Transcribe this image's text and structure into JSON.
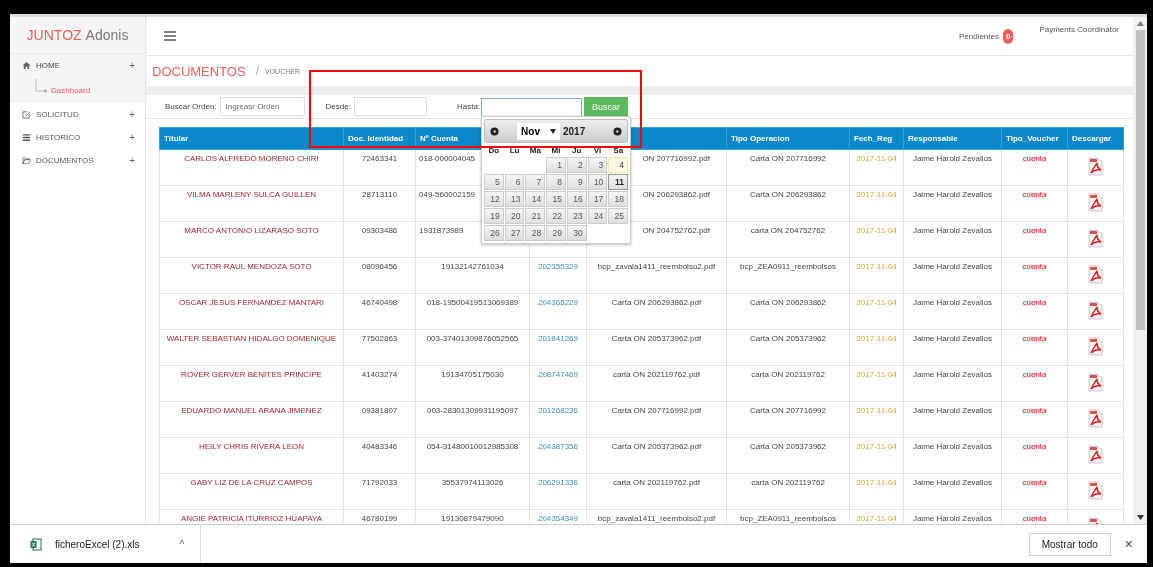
{
  "brand": {
    "accent": "JUNTOZ",
    "rest": "Adonis"
  },
  "sidebar": {
    "items": [
      {
        "label": "HOME",
        "expand": "+",
        "expanded": true,
        "children": [
          {
            "label": "Dashboard",
            "selected": true
          }
        ]
      },
      {
        "label": "SOLICITUD",
        "expand": "+",
        "expanded": false
      },
      {
        "label": "HISTORICO",
        "expand": "+",
        "expanded": false
      },
      {
        "label": "DOCUMENTOS",
        "expand": "+",
        "expanded": false
      }
    ]
  },
  "topbar": {
    "pending_label": "Pendientes",
    "pending_count": "0",
    "user": "Payments Coordinator"
  },
  "page": {
    "title": "DOCUMENTOS",
    "separator": "/",
    "breadcrumb": "VOUCHER"
  },
  "filters": {
    "order_label": "Buscar Orden:",
    "order_placeholder": "Ingreasr Orden",
    "from_label": "Desde:",
    "to_label": "Hasta:",
    "button": "Buscar"
  },
  "calendar": {
    "month": "Nov",
    "year": "2017",
    "weekdays": [
      "Do",
      "Lu",
      "Ma",
      "Mi",
      "Ju",
      "Vi",
      "Sa"
    ],
    "weeks": [
      {
        "right_aligned": true,
        "days": [
          {
            "d": "1",
            "today": false,
            "selected": false
          },
          {
            "d": "2",
            "today": false,
            "selected": false
          },
          {
            "d": "3",
            "today": false,
            "selected": false
          },
          {
            "d": "4",
            "today": true,
            "selected": false
          }
        ]
      },
      {
        "days": [
          {
            "d": "5",
            "today": false,
            "selected": false
          },
          {
            "d": "6",
            "today": false,
            "selected": false
          },
          {
            "d": "7",
            "today": false,
            "selected": false
          },
          {
            "d": "8",
            "today": false,
            "selected": false
          },
          {
            "d": "9",
            "today": false,
            "selected": false
          },
          {
            "d": "10",
            "today": false,
            "selected": false
          },
          {
            "d": "11",
            "today": false,
            "selected": true
          }
        ]
      },
      {
        "days": [
          {
            "d": "12",
            "today": false,
            "selected": false
          },
          {
            "d": "13",
            "today": false,
            "selected": false
          },
          {
            "d": "14",
            "today": false,
            "selected": false
          },
          {
            "d": "15",
            "today": false,
            "selected": false
          },
          {
            "d": "16",
            "today": false,
            "selected": false
          },
          {
            "d": "17",
            "today": false,
            "selected": false
          },
          {
            "d": "18",
            "today": false,
            "selected": false
          }
        ]
      },
      {
        "days": [
          {
            "d": "19",
            "today": false,
            "selected": false
          },
          {
            "d": "20",
            "today": false,
            "selected": false
          },
          {
            "d": "21",
            "today": false,
            "selected": false
          },
          {
            "d": "22",
            "today": false,
            "selected": false
          },
          {
            "d": "23",
            "today": false,
            "selected": false
          },
          {
            "d": "24",
            "today": false,
            "selected": false
          },
          {
            "d": "25",
            "today": false,
            "selected": false
          }
        ]
      },
      {
        "days": [
          {
            "d": "26",
            "today": false,
            "selected": false
          },
          {
            "d": "27",
            "today": false,
            "selected": false
          },
          {
            "d": "28",
            "today": false,
            "selected": false
          },
          {
            "d": "29",
            "today": false,
            "selected": false
          },
          {
            "d": "30",
            "today": false,
            "selected": false
          }
        ]
      }
    ]
  },
  "table": {
    "columns": [
      "Titular",
      "Doc. Identidad",
      "Nº Cuenta",
      null,
      null,
      "Tipo Operacion",
      "Fech_Reg",
      "Responsable",
      "Tipo_Voucher",
      "Descargar"
    ],
    "rows": [
      {
        "cells": [
          "CARLOS ALFREDO MORENO CHIRI",
          "72463341",
          {
            "text": "018-000004045",
            "align_left": true
          },
          null,
          {
            "text": "ON 207716992.pdf",
            "align_right": true
          },
          "Carta ON 207716992",
          "2017-11-04",
          "Jaime Harold Zevallos",
          "cuenta"
        ]
      },
      {
        "cells": [
          "VILMA MARLENY SULCA GUILLEN",
          "28713110",
          {
            "text": "049-560002159",
            "align_left": true
          },
          null,
          {
            "text": "ON 206293862.pdf",
            "align_right": true
          },
          "Carta ON 206293862",
          "2017-11-04",
          "Jaime Harold Zevallos",
          "cuenta"
        ]
      },
      {
        "cells": [
          "MARCO ANTONIO LIZARASO SOTO",
          "09303486",
          {
            "text": "1931873989",
            "align_left": true
          },
          null,
          {
            "text": "ON 204752762.pdf",
            "align_right": true
          },
          "carta ON 204752762",
          "2017-11-04",
          "Jaime Harold Zevallos",
          "cuenta"
        ]
      },
      {
        "cells": [
          "VICTOR RAUL MENDOZA SOTO",
          "08096456",
          "19132142761034",
          "202355329",
          "bcp_zavala1411_reembolso2.pdf",
          "bcp_ZEA0911_reembolsos",
          "2017-11-04",
          "Jaime Harold Zevallos",
          "cuenta"
        ]
      },
      {
        "cells": [
          "OSCAR JESUS FERNANDEZ MANTARI",
          "46740498",
          "018-19500419513069389",
          "204365229",
          "Carta ON 206293862.pdf",
          "Carta ON 206293862",
          "2017-11-04",
          "Jaime Harold Zevallos",
          "cuenta"
        ]
      },
      {
        "cells": [
          "WALTER SEBASTIAN HIDALGO DOMENIQUE",
          "77502863",
          "003-37401309876052565",
          "201841269",
          "Carta ON 205373962.pdf",
          "Carta ON 205373962",
          "2017-11-04",
          "Jaime Harold Zevallos",
          "cuenta"
        ]
      },
      {
        "cells": [
          "ROVER GERVER BENITES PRINCIPE",
          "41403274",
          "19134705175030",
          "208747469",
          "carta ON 202119762.pdf",
          "carta ON 202119762",
          "2017-11-04",
          "Jaime Harold Zevallos",
          "cuenta"
        ]
      },
      {
        "cells": [
          "EDUARDO MANUEL ARANA JIMENEZ",
          "09381807",
          "003-28301309931195097",
          "201268236",
          "Carta ON 207716992.pdf",
          "Carta ON 207716992",
          "2017-11-04",
          "Jaime Harold Zevallos",
          "cuenta"
        ]
      },
      {
        "cells": [
          "HEILY CHRIS RIVERA LEON",
          "40483346",
          "054-31480010012985308",
          "204387356",
          "Carta ON 205373962.pdf",
          "Carta ON 205373962",
          "2017-11-04",
          "Jaime Harold Zevallos",
          "cuenta"
        ]
      },
      {
        "cells": [
          "GABY LIZ DE LA CRUZ CAMPOS",
          "71792033",
          "35537974113026",
          "206291336",
          "carta ON 202119762.pdf",
          "carta ON 202119762",
          "2017-11-04",
          "Jaime Harold Zevallos",
          "cuenta"
        ]
      },
      {
        "cells": [
          "ANGIE PATRICIA ITURRIOZ HUAPAYA",
          "46780199",
          "19130879479090",
          "204354349",
          "bcp_zavala1411_reembolso2.pdf",
          "bcp_ZEA0911_reembolsos",
          "2017-11-04",
          "Jaime Harold Zevallos",
          "cuenta"
        ]
      }
    ]
  },
  "downloads": {
    "file": "ficheroExcel (2).xls",
    "caret": "^",
    "show_all": "Mostrar todo",
    "close": "×"
  }
}
